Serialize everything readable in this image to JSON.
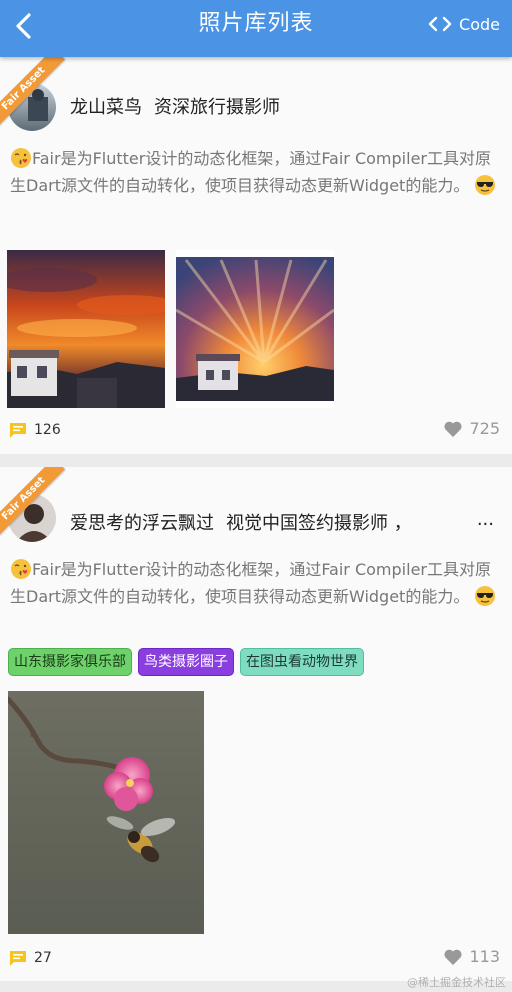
{
  "header": {
    "title": "照片库列表",
    "code_label": "Code",
    "bg": "#4a93e5"
  },
  "ribbon_label": "Fair Asset",
  "posts": [
    {
      "author": "龙山菜鸟",
      "role": "资深旅行摄影师",
      "description": "Fair是为Flutter设计的动态化框架，通过Fair Compiler工具对原生Dart源文件的自动转化，使项目获得动态更新Widget的能力。",
      "comments": "126",
      "likes": "725",
      "photos": [
        "fiery-sunset-over-houses",
        "sunburst-rays-over-houses"
      ]
    },
    {
      "author": "爱思考的浮云飘过",
      "role": "视觉中国签约摄影师 ，",
      "ellipsis": "...",
      "description": "Fair是为Flutter设计的动态化框架，通过Fair Compiler工具对原生Dart源文件的自动转化，使项目获得动态更新Widget的能力。",
      "tags": [
        {
          "label": "山东摄影家俱乐部",
          "bg": "#6ed26a",
          "border": "#4fb04b",
          "color": "#1b3b1a"
        },
        {
          "label": "鸟类摄影圈子",
          "bg": "#8b3ee0",
          "border": "#6e26c4",
          "color": "#ffffff"
        },
        {
          "label": "在图虫看动物世界",
          "bg": "#7fdcc0",
          "border": "#4fbfa0",
          "color": "#1a3a32"
        }
      ],
      "comments": "27",
      "likes": "113",
      "photos": [
        "bee-and-pink-blossom"
      ]
    }
  ],
  "watermark": "@稀土掘金技术社区"
}
